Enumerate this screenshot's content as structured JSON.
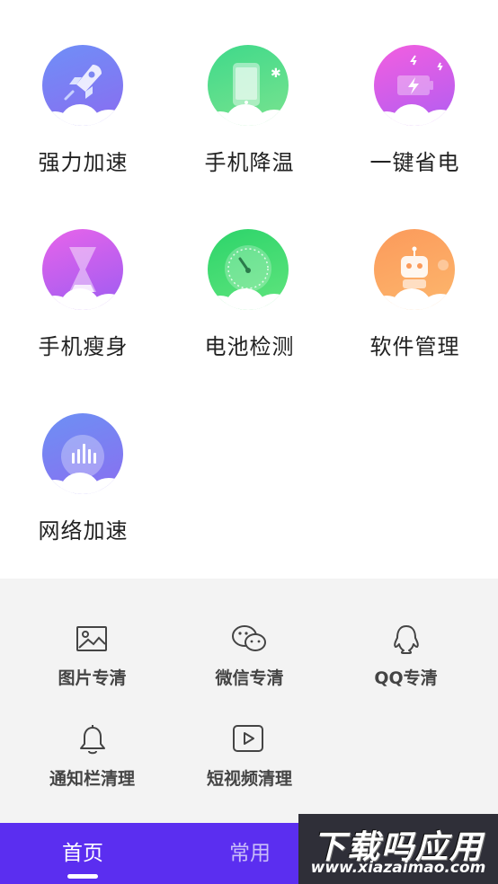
{
  "features": [
    {
      "label": "强力加速",
      "icon": "rocket-icon",
      "gradient": [
        "#6b8bf5",
        "#8a6df0"
      ]
    },
    {
      "label": "手机降温",
      "icon": "phone-snowflake-icon",
      "gradient": [
        "#34d27a",
        "#7fe48a"
      ]
    },
    {
      "label": "一键省电",
      "icon": "battery-bolt-icon",
      "gradient": [
        "#f05de0",
        "#b15cf2"
      ]
    },
    {
      "label": "手机瘦身",
      "icon": "hourglass-icon",
      "gradient": [
        "#e15ee8",
        "#a05cf2"
      ]
    },
    {
      "label": "电池检测",
      "icon": "gauge-icon",
      "gradient": [
        "#2fd36b",
        "#5ee47c"
      ]
    },
    {
      "label": "软件管理",
      "icon": "robot-icon",
      "gradient": [
        "#fb9a59",
        "#fcb46a"
      ]
    },
    {
      "label": "网络加速",
      "icon": "signal-bars-icon",
      "gradient": [
        "#6e8ef3",
        "#8a6ef0"
      ]
    }
  ],
  "tools": [
    {
      "label": "图片专清",
      "icon": "image-icon"
    },
    {
      "label": "微信专清",
      "icon": "wechat-icon"
    },
    {
      "label": "QQ专清",
      "icon": "qq-icon"
    },
    {
      "label": "通知栏清理",
      "icon": "bell-icon"
    },
    {
      "label": "短视频清理",
      "icon": "play-video-icon"
    }
  ],
  "tabbar": {
    "home": "首页",
    "common": "常用",
    "accent": "#5b2ef0"
  },
  "watermark": {
    "title": "下载吗应用",
    "url": "www.xiazaimao.com"
  }
}
